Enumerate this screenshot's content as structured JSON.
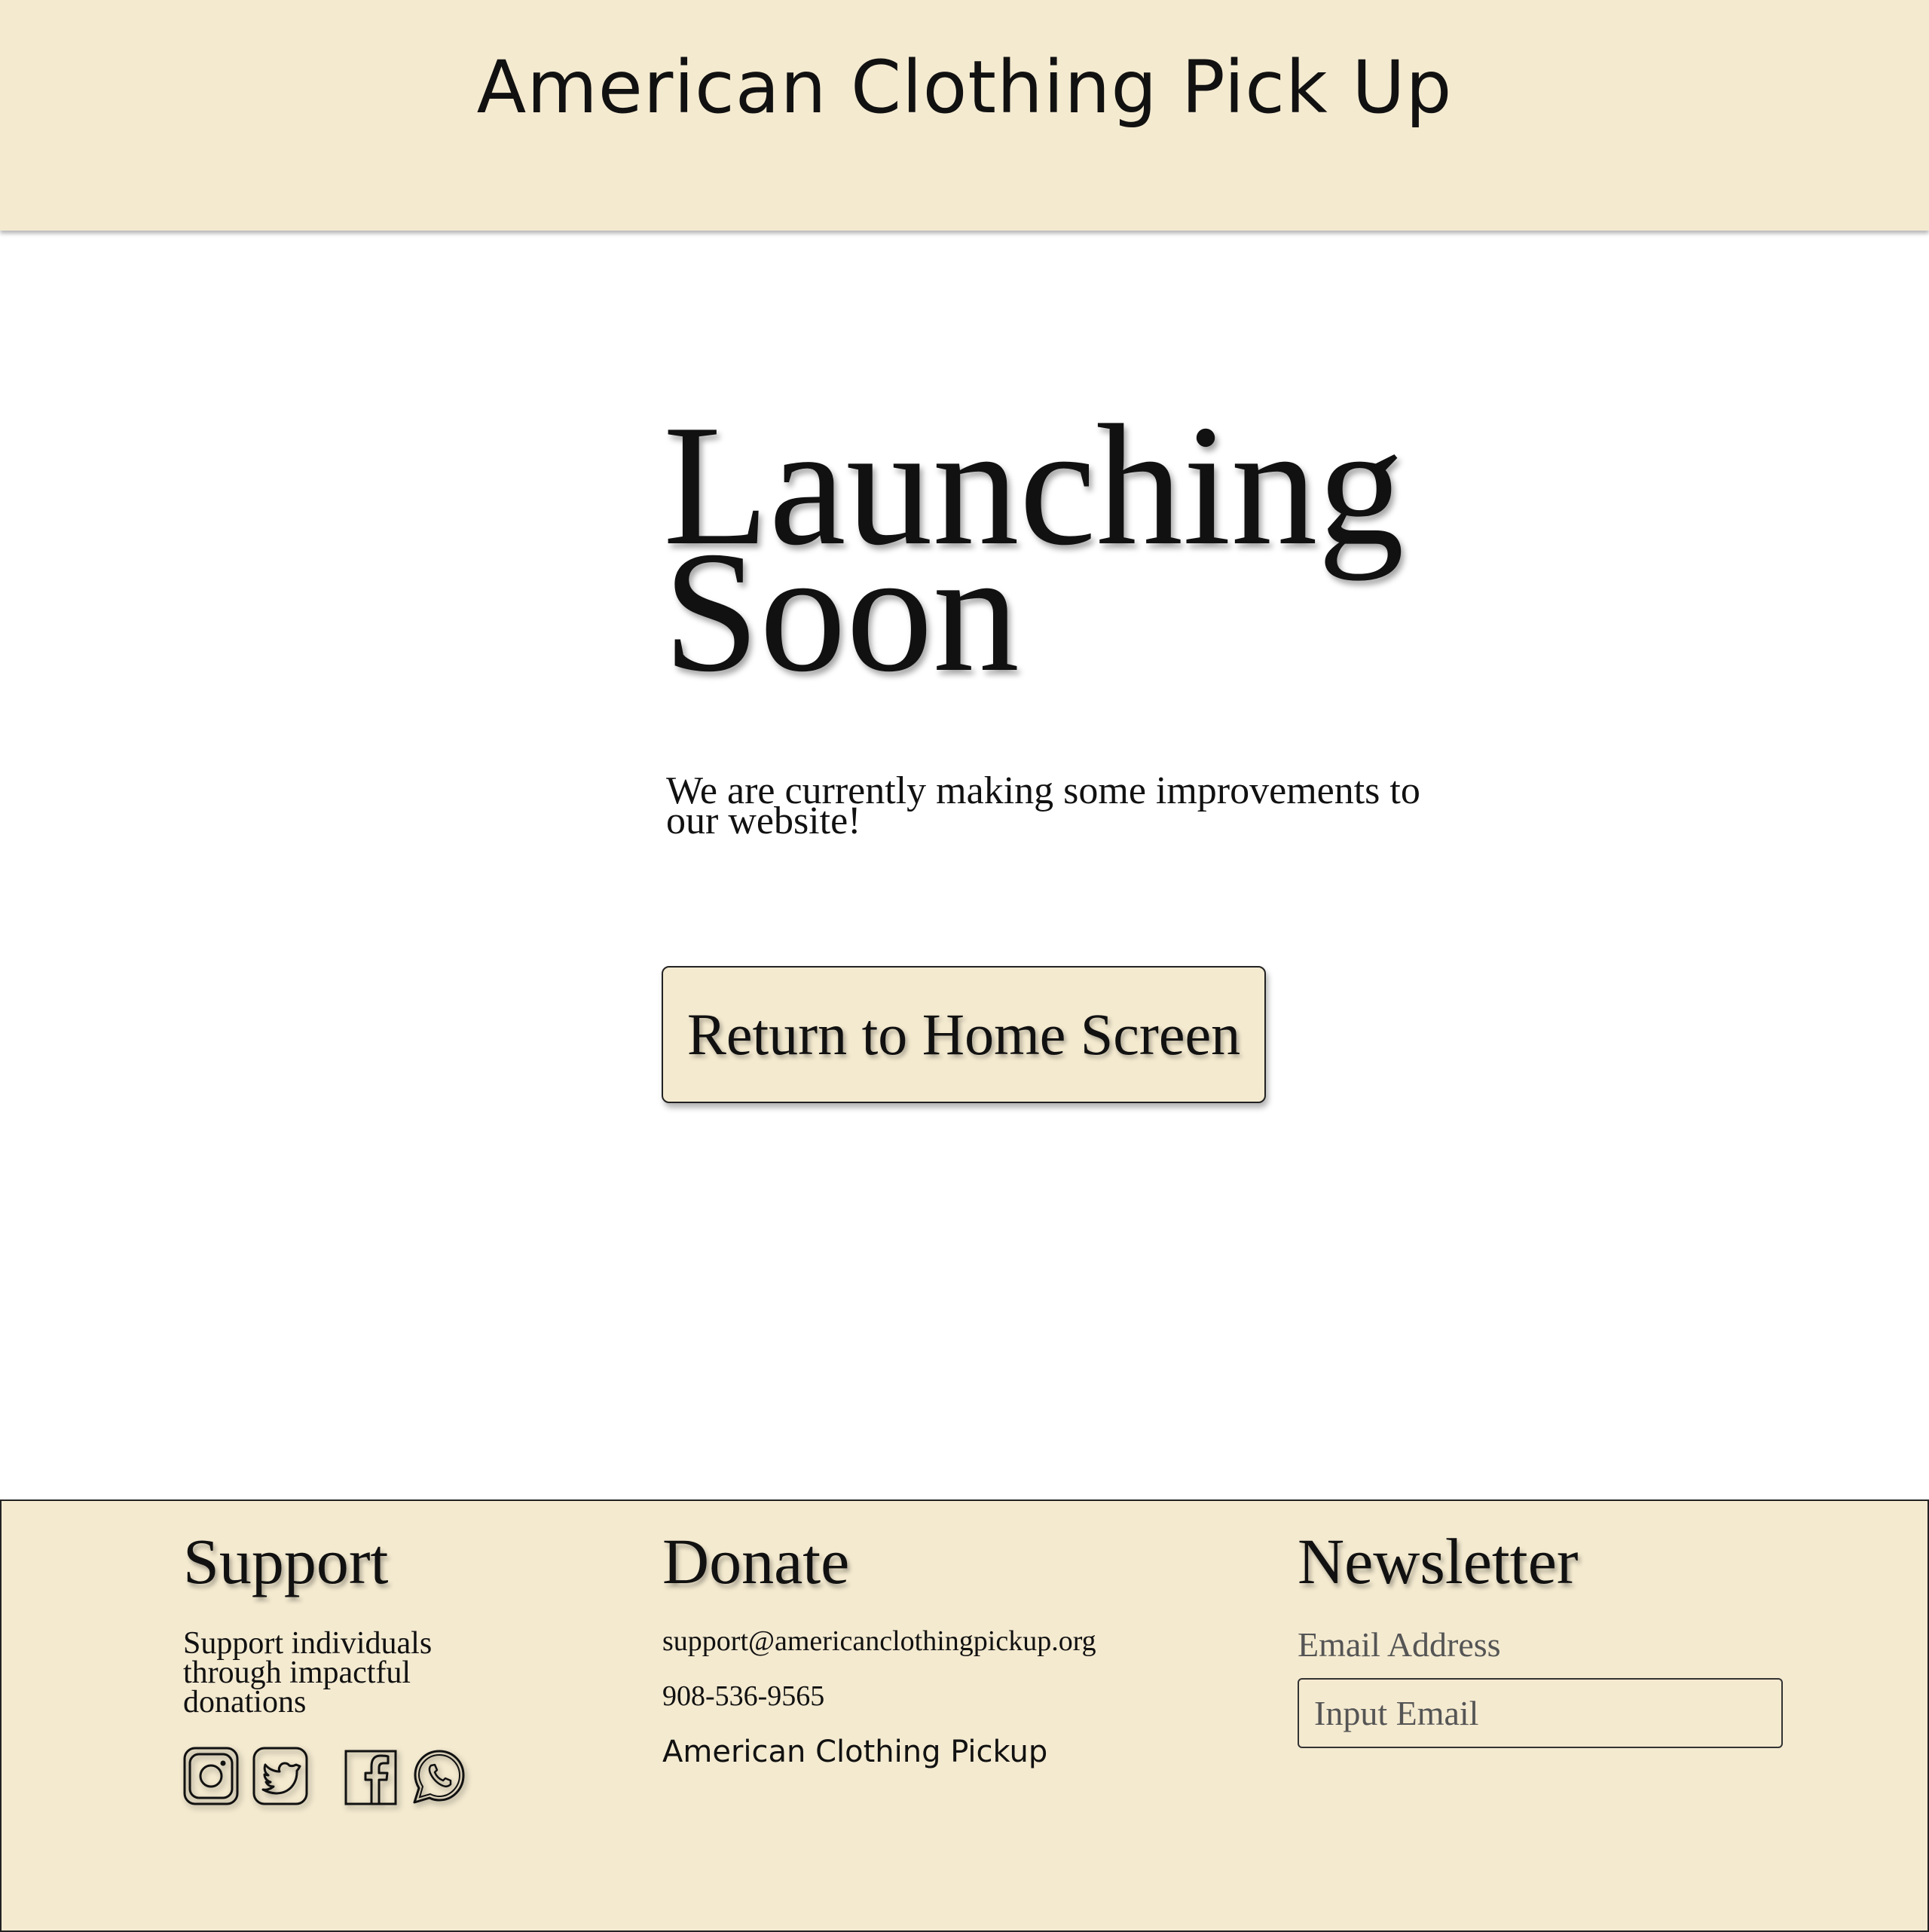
{
  "header": {
    "site_title": "American Clothing Pick Up"
  },
  "hero": {
    "title_line1": "Launching",
    "title_line2": "Soon",
    "subtitle": "We are currently making some improvements to our website!",
    "button_label": "Return to Home Screen"
  },
  "footer": {
    "support": {
      "heading": "Support",
      "text": "Support individuals through impactful donations",
      "socials": [
        {
          "name": "instagram-icon"
        },
        {
          "name": "twitter-icon"
        },
        {
          "name": "facebook-icon"
        },
        {
          "name": "whatsapp-icon"
        }
      ]
    },
    "donate": {
      "heading": "Donate",
      "email": "support@americanclothingpickup.org",
      "phone": "908-536-9565",
      "brand": "American Clothing Pickup"
    },
    "newsletter": {
      "heading": "Newsletter",
      "email_label": "Email Address",
      "email_placeholder": "Input Email"
    }
  },
  "colors": {
    "cream": "#f4ead0",
    "text": "#111111",
    "muted": "#555555"
  }
}
